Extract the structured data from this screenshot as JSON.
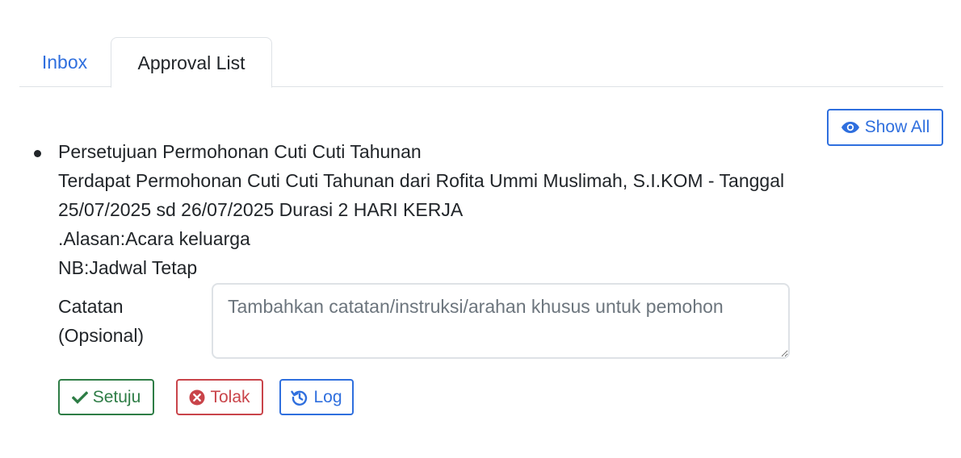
{
  "tabs": [
    {
      "label": "Inbox",
      "active": false
    },
    {
      "label": "Approval List",
      "active": true
    }
  ],
  "show_all_label": "Show All",
  "item": {
    "title": "Persetujuan Permohonan Cuti Cuti Tahunan",
    "line1": "Terdapat Permohonan Cuti Cuti Tahunan dari Rofita Ummi Muslimah, S.I.KOM - Tanggal",
    "line2": "25/07/2025 sd 26/07/2025 Durasi 2 HARI KERJA",
    "reason": ".Alasan:Acara keluarga",
    "note": "NB:Jadwal Tetap"
  },
  "notes_field": {
    "label_line1": "Catatan",
    "label_line2": "(Opsional)",
    "value": "",
    "placeholder": "Tambahkan catatan/instruksi/arahan khusus untuk pemohon"
  },
  "actions": {
    "approve_label": "Setuju",
    "reject_label": "Tolak",
    "log_label": "Log"
  },
  "colors": {
    "primary": "#2f6fde",
    "success": "#2e7d46",
    "danger": "#c9444a"
  },
  "icons": {
    "show_all": "eye-icon",
    "approve": "check-icon",
    "reject": "times-circle-icon",
    "log": "history-icon"
  }
}
